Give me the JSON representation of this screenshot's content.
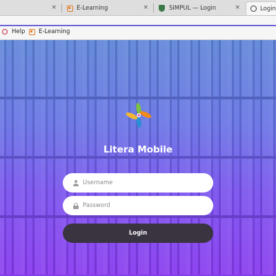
{
  "browser": {
    "tabs": [
      {
        "label": "",
        "favicon": "none"
      },
      {
        "label": "E-Learning",
        "favicon": "orange-square-icon"
      },
      {
        "label": "SIMPUL — Login",
        "favicon": "shield-icon"
      },
      {
        "label": "Login",
        "favicon": "globe-icon"
      }
    ],
    "close_glyph": "×",
    "bookmarks": [
      {
        "label": "Help",
        "favicon": "help-icon"
      },
      {
        "label": "E-Learning",
        "favicon": "orange-square-icon"
      }
    ]
  },
  "page": {
    "app_title": "Litera Mobile",
    "username_placeholder": "Username",
    "password_placeholder": "Password",
    "login_label": "Login",
    "colors": {
      "gradient_top": "#5f86d8",
      "gradient_bottom": "#8a3aef",
      "button_bg": "#3a3340"
    }
  }
}
